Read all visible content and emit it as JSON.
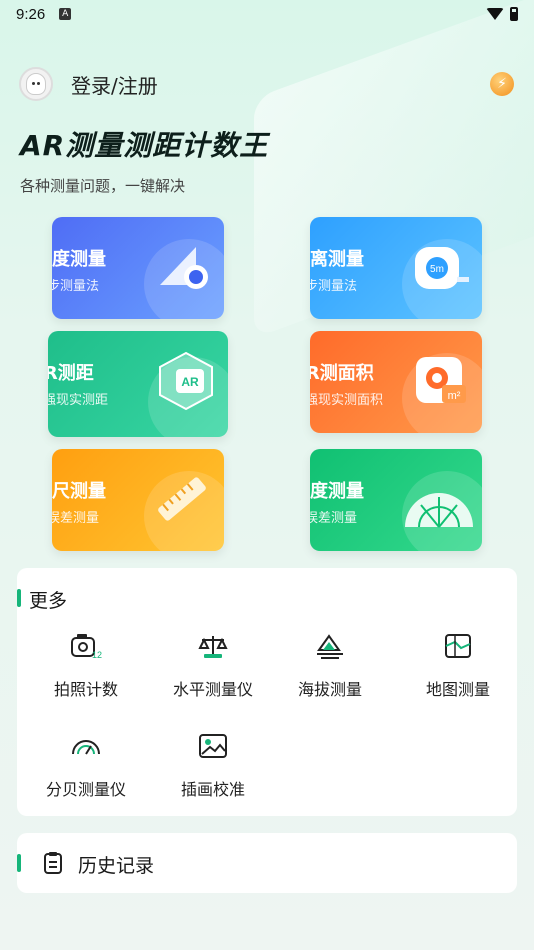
{
  "status_bar": {
    "time": "9:26",
    "notif_letter": "A"
  },
  "header": {
    "login_label": "登录/注册"
  },
  "app": {
    "title": "AR测量测距计数王",
    "subtitle": "各种测量问题，一键解决"
  },
  "cards": [
    {
      "title": "高度测量",
      "subtitle": "三步测量法",
      "icon": "ruler-triangle-icon"
    },
    {
      "title": "距离测量",
      "subtitle": "二步测量法",
      "icon": "tape-measure-icon",
      "icon_text": "5m"
    },
    {
      "title": "AR测距",
      "subtitle": "增强现实测距",
      "icon": "ar-cube-icon",
      "icon_text": "AR"
    },
    {
      "title": "AR测面积",
      "subtitle": "增强现实测面积",
      "icon": "area-camera-icon",
      "icon_text": "m²"
    },
    {
      "title": "直尺测量",
      "subtitle": "零误差测量",
      "icon": "ruler-icon"
    },
    {
      "title": "角度测量",
      "subtitle": "零误差测量",
      "icon": "protractor-icon"
    }
  ],
  "more": {
    "title": "更多",
    "tools": [
      {
        "label": "拍照计数",
        "icon": "camera-count-icon",
        "icon_text": "12"
      },
      {
        "label": "水平测量仪",
        "icon": "level-icon"
      },
      {
        "label": "海拔测量",
        "icon": "altitude-icon"
      },
      {
        "label": "地图测量",
        "icon": "map-icon"
      },
      {
        "label": "分贝测量仪",
        "icon": "decibel-gauge-icon"
      },
      {
        "label": "插画校准",
        "icon": "image-icon"
      }
    ]
  },
  "history": {
    "title": "历史记录",
    "icon": "clipboard-icon"
  },
  "colors": {
    "accent": "#16b57a"
  }
}
